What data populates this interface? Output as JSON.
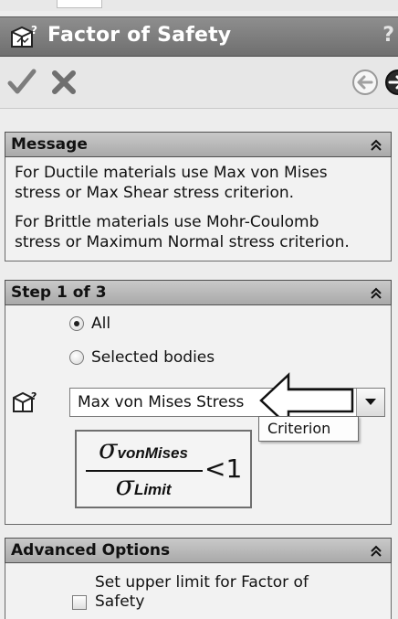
{
  "window": {
    "title": "Factor of Safety",
    "help_label": "?"
  },
  "toolbar": {
    "ok_icon": "checkmark-icon",
    "cancel_icon": "x-icon",
    "back_icon": "arrow-left-icon",
    "next_icon": "arrow-right-icon"
  },
  "message": {
    "title": "Message",
    "paragraph1_line1": "For Ductile materials use Max von Mises",
    "paragraph1_line2": "stress or Max Shear stress criterion.",
    "paragraph2_line1": "For Brittle materials use Mohr-Coulomb",
    "paragraph2_line2": "stress or Maximum Normal stress criterion."
  },
  "step": {
    "title": "Step 1 of 3",
    "options": [
      "All",
      "Selected bodies"
    ],
    "selected_option": "All",
    "criterion_value": "Max von Mises Stress",
    "tooltip": "Criterion",
    "formula": {
      "numerator_symbol": "σ",
      "numerator_subscript": "vonMises",
      "denominator_symbol": "σ",
      "denominator_subscript": "Limit",
      "comparison": "<1"
    }
  },
  "advanced": {
    "title": "Advanced Options",
    "checkbox_line1": "Set upper limit for Factor of",
    "checkbox_line2": "Safety",
    "checked": false
  },
  "colors": {
    "title_bar": "#7f7f7f",
    "section_header": "#b9b9b9",
    "panel_bg": "#f2f2f2",
    "accent_dark": "#1f1f1f"
  }
}
